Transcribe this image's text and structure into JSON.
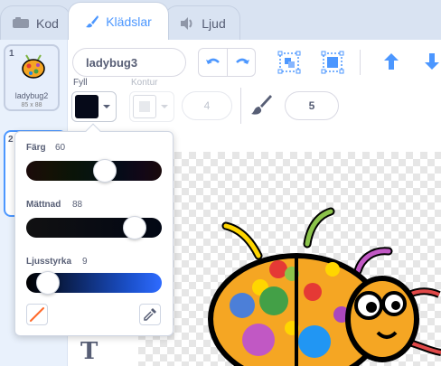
{
  "tabs": {
    "code_label": "Kod",
    "costumes_label": "Klädslar",
    "sounds_label": "Ljud"
  },
  "costumes": [
    {
      "number": "1",
      "name": "ladybug2",
      "size": "85 x 88"
    },
    {
      "number": "2"
    }
  ],
  "editor": {
    "costume_name": "ladybug3",
    "fill_label": "Fyll",
    "outline_label": "Kontur",
    "outline_width": "4",
    "brush_size": "5",
    "fill_color": "#060a19"
  },
  "color_picker": {
    "hue_label": "Färg",
    "hue_value": "60",
    "saturation_label": "Mättnad",
    "saturation_value": "88",
    "brightness_label": "Ljusstyrka",
    "brightness_value": "9"
  },
  "icons": {
    "code": "code-icon",
    "costumes": "brush-icon",
    "sounds": "speaker-icon",
    "undo": "undo-icon",
    "redo": "redo-icon",
    "group": "group-icon",
    "ungroup": "ungroup-icon",
    "forward": "forward-icon",
    "backward": "backward-icon",
    "no_color": "no-color-icon",
    "eyedropper": "eyedropper-icon",
    "text_tool": "T"
  },
  "accent_color": "#4c97ff"
}
